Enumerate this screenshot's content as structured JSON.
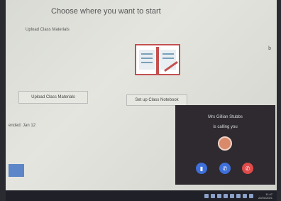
{
  "page": {
    "title": "Choose where you want to start",
    "upload_heading": "Upload Class Materials",
    "right_marker": "b",
    "added_text": "ended: Jan 12"
  },
  "buttons": {
    "upload_label": "Upload Class Materials",
    "notebook_label": "Set up Class Notebook"
  },
  "call": {
    "caller_name": "Mrs Gillian Stubbs",
    "status": "is calling you",
    "video_icon": "video-icon",
    "audio_icon": "phone-icon",
    "decline_icon": "hang-up-icon",
    "video_color": "#3f6fd9",
    "decline_color": "#e04a4a"
  },
  "taskbar": {
    "time": "11:47",
    "date": "22/01/2021"
  },
  "colors": {
    "accent_red": "#c45050",
    "blue_square": "#5d86c8"
  }
}
